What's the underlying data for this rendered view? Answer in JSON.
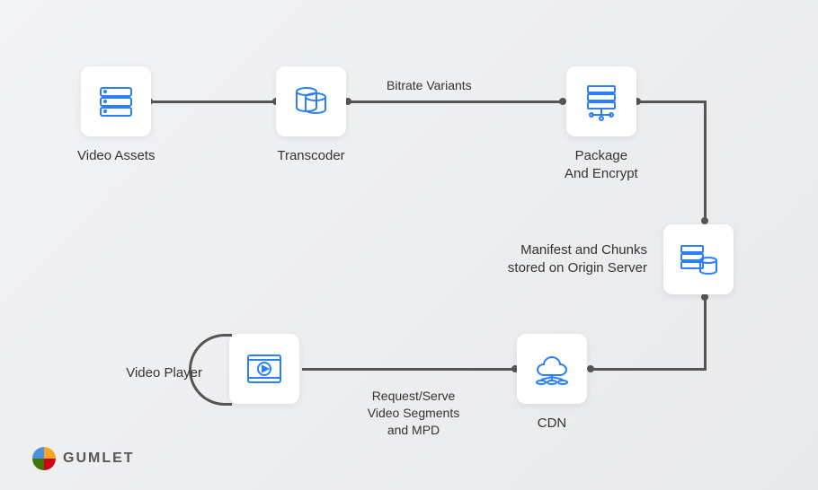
{
  "nodes": {
    "video_assets": {
      "label": "Video Assets"
    },
    "transcoder": {
      "label": "Transcoder"
    },
    "package": {
      "label_line1": "Package",
      "label_line2": "And Encrypt"
    },
    "origin": {
      "label_line1": "Manifest and Chunks",
      "label_line2": "stored on Origin Server"
    },
    "cdn": {
      "label": "CDN"
    },
    "player": {
      "label": "Video Player"
    }
  },
  "edges": {
    "bitrate": {
      "label": "Bitrate Variants"
    },
    "request": {
      "label_line1": "Request/Serve",
      "label_line2": "Video Segments",
      "label_line3": "and MPD"
    }
  },
  "brand": {
    "name": "GUMLET"
  },
  "colors": {
    "accent": "#2b7fff",
    "line": "#555"
  }
}
